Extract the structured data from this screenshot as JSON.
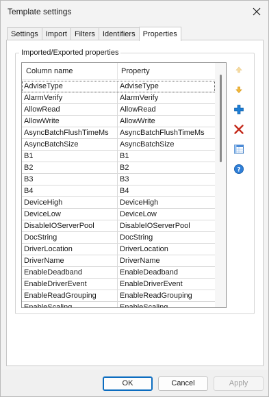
{
  "window": {
    "title": "Template settings"
  },
  "tabs": [
    {
      "label": "Settings",
      "active": false
    },
    {
      "label": "Import",
      "active": false
    },
    {
      "label": "Filters",
      "active": false
    },
    {
      "label": "Identifiers",
      "active": false
    },
    {
      "label": "Properties",
      "active": true
    }
  ],
  "group": {
    "label": "Imported/Exported properties"
  },
  "grid": {
    "columns": [
      "Column name",
      "Property"
    ],
    "rows": [
      [
        "AdviseType",
        "AdviseType"
      ],
      [
        "AlarmVerify",
        "AlarmVerify"
      ],
      [
        "AllowRead",
        "AllowRead"
      ],
      [
        "AllowWrite",
        "AllowWrite"
      ],
      [
        "AsyncBatchFlushTimeMs",
        "AsyncBatchFlushTimeMs"
      ],
      [
        "AsyncBatchSize",
        "AsyncBatchSize"
      ],
      [
        "B1",
        "B1"
      ],
      [
        "B2",
        "B2"
      ],
      [
        "B3",
        "B3"
      ],
      [
        "B4",
        "B4"
      ],
      [
        "DeviceHigh",
        "DeviceHigh"
      ],
      [
        "DeviceLow",
        "DeviceLow"
      ],
      [
        "DisableIOServerPool",
        "DisableIOServerPool"
      ],
      [
        "DocString",
        "DocString"
      ],
      [
        "DriverLocation",
        "DriverLocation"
      ],
      [
        "DriverName",
        "DriverName"
      ],
      [
        "EnableDeadband",
        "EnableDeadband"
      ],
      [
        "EnableDriverEvent",
        "EnableDriverEvent"
      ],
      [
        "EnableReadGrouping",
        "EnableReadGrouping"
      ],
      [
        "EnableScaling",
        "EnableScaling"
      ]
    ]
  },
  "side_buttons": [
    "move-up-icon",
    "move-down-icon",
    "add-icon",
    "delete-icon",
    "table-icon",
    "help-icon"
  ],
  "footer": {
    "ok": "OK",
    "cancel": "Cancel",
    "apply": "Apply"
  },
  "colors": {
    "accent": "#0a6bbf",
    "add": "#1e7fd6",
    "delete": "#c42b1c",
    "arrow": "#f0b43c"
  }
}
